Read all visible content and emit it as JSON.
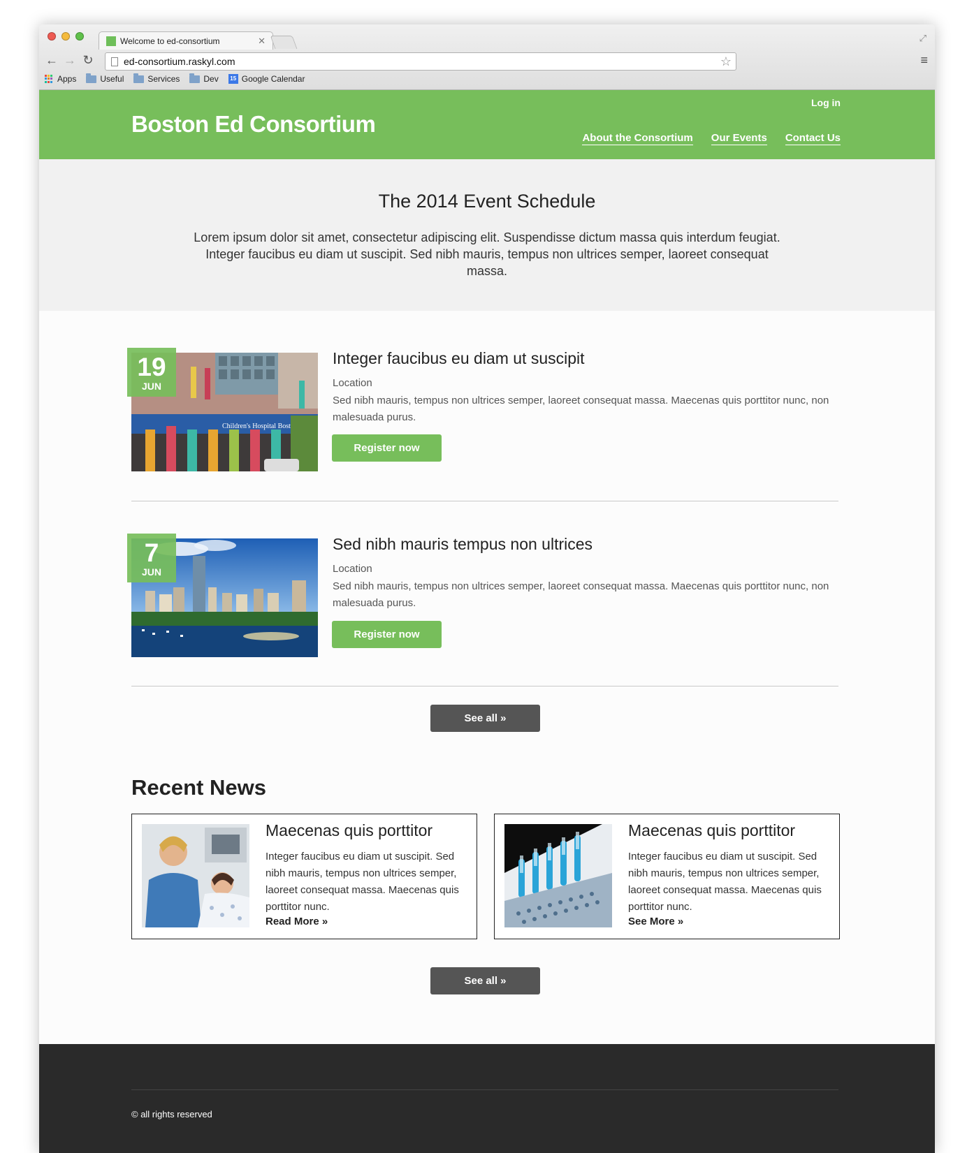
{
  "browser": {
    "tab_title": "Welcome to ed-consortium",
    "url": "ed-consortium.raskyl.com",
    "bookmarks": [
      "Apps",
      "Useful",
      "Services",
      "Dev",
      "Google Calendar"
    ],
    "calendar_badge": "15"
  },
  "site": {
    "brand": "Boston Ed Consortium",
    "login": "Log in",
    "nav": [
      "About the Consortium",
      "Our Events",
      "Contact Us"
    ]
  },
  "hero": {
    "title": "The 2014 Event Schedule",
    "text": "Lorem ipsum dolor sit amet, consectetur adipiscing elit. Suspendisse dictum massa quis interdum feugiat. Integer faucibus eu diam ut suscipit. Sed nibh mauris, tempus non ultrices semper, laoreet consequat massa."
  },
  "events": [
    {
      "day": "19",
      "month": "JUN",
      "title": "Integer faucibus eu diam ut suscipit",
      "location": "Location",
      "description": "Sed nibh mauris, tempus non ultrices semper, laoreet consequat massa. Maecenas quis porttitor nunc, non malesuada purus.",
      "button": "Register now",
      "image_sign": "Children's Hospital Boston"
    },
    {
      "day": "7",
      "month": "JUN",
      "title": "Sed nibh mauris tempus non ultrices",
      "location": "Location",
      "description": "Sed nibh mauris, tempus non ultrices semper, laoreet consequat massa. Maecenas quis porttitor nunc, non malesuada purus.",
      "button": "Register now"
    }
  ],
  "events_see_all": "See all »",
  "news": {
    "heading": "Recent News",
    "items": [
      {
        "title": "Maecenas quis porttitor",
        "text": "Integer faucibus eu diam ut suscipit. Sed nibh mauris, tempus non ultrices semper, laoreet consequat massa. Maecenas quis porttitor nunc.",
        "more": "Read More »"
      },
      {
        "title": "Maecenas quis porttitor",
        "text": "Integer faucibus eu diam ut suscipit. Sed nibh mauris, tempus non ultrices semper, laoreet consequat massa. Maecenas quis porttitor nunc.",
        "more": "See More »"
      }
    ],
    "see_all": "See all »"
  },
  "footer": {
    "copyright": "© all rights reserved"
  },
  "colors": {
    "brand_green": "#77be5b",
    "dark_button": "#555555",
    "footer_bg": "#2a2a2a",
    "hero_bg": "#f1f1f1"
  }
}
